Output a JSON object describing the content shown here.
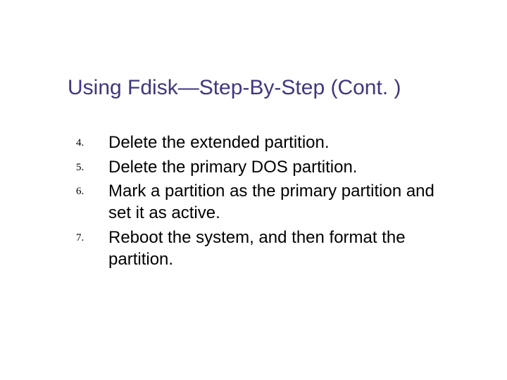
{
  "slide": {
    "title": "Using Fdisk—Step-By-Step (Cont. )",
    "items": [
      {
        "marker": "4.",
        "text": "Delete the extended partition."
      },
      {
        "marker": "5.",
        "text": "Delete the primary DOS partition."
      },
      {
        "marker": "6.",
        "text": "Mark a partition as the primary partition and set it as active."
      },
      {
        "marker": "7.",
        "text": "Reboot the system, and then format the partition."
      }
    ]
  }
}
